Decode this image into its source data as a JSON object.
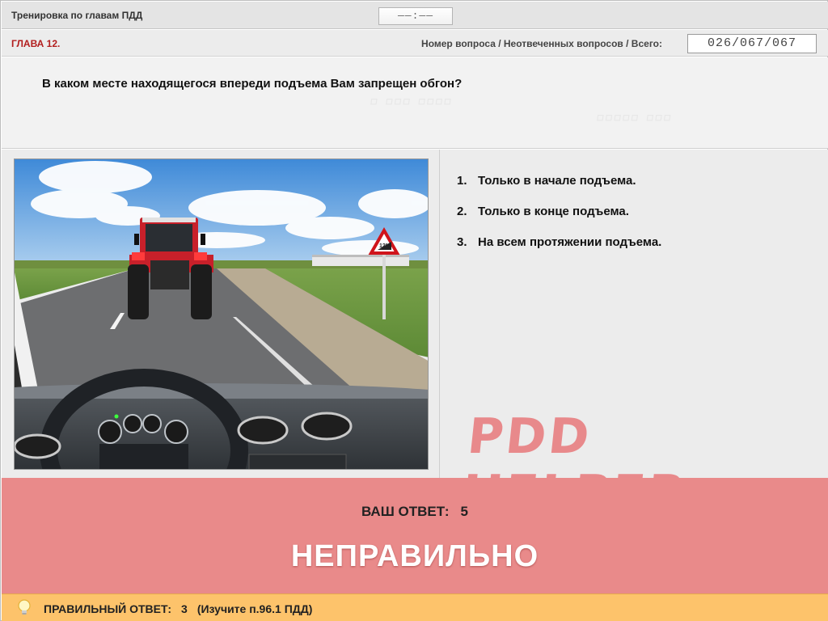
{
  "header": {
    "title": "Тренировка по главам ПДД",
    "timer": "——:——"
  },
  "chapter_bar": {
    "chapter": "ГЛАВА 12.",
    "counter_label": "Номер вопроса / Неотвеченных вопросов / Всего:",
    "counter_value": "026/067/067"
  },
  "question": {
    "text": "В каком месте находящегося впереди подъема Вам запрещен обгон?"
  },
  "answers": [
    {
      "num": "1.",
      "text": "Только в начале подъема."
    },
    {
      "num": "2.",
      "text": "Только в конце подъема."
    },
    {
      "num": "3.",
      "text": "На всем протяжении подъема."
    }
  ],
  "brand": "PDD HELPER",
  "result": {
    "your_answer_label": "ВАШ ОТВЕТ:",
    "your_answer_value": "5",
    "verdict": "НЕПРАВИЛЬНО",
    "background": "#e98a8a"
  },
  "correct": {
    "label": "ПРАВИЛЬНЫЙ ОТВЕТ:",
    "value": "3",
    "hint": "(Изучите п.96.1 ПДД)",
    "background": "#fdc36b"
  },
  "icons": {
    "bulb": "lightbulb-icon",
    "sign": "steep-hill-sign-icon"
  },
  "scene_sign_text": "12%"
}
